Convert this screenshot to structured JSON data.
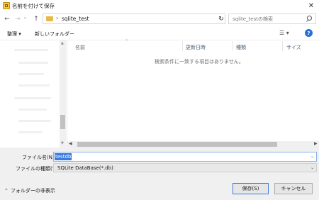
{
  "window": {
    "title": "名前を付けて保存",
    "close_glyph": "✕"
  },
  "address": {
    "back_glyph": "←",
    "forward_glyph": "→",
    "recent_glyph": "⌄",
    "up_glyph": "↑",
    "separator": "›",
    "path": "sqlite_test",
    "dropdown_glyph": "⌄",
    "refresh_glyph": "↻"
  },
  "search": {
    "placeholder": "sqlite_testの検索"
  },
  "toolbar": {
    "organize_label": "整理 ▾",
    "new_folder_label": "新しいフォルダー",
    "view_glyph": "☰ ▾",
    "help_glyph": "?"
  },
  "file_list": {
    "columns": [
      "名前",
      "更新日時",
      "種類",
      "サイズ"
    ],
    "sort_glyph": "⌃",
    "empty_message": "検索条件に一致する項目はありません。"
  },
  "scrollbar": {
    "left_glyph": "◀",
    "right_glyph": "▶",
    "up_glyph": "▲",
    "down_glyph": "▼"
  },
  "form": {
    "filename_label": "ファイル名(N):",
    "filename_value": "testdb",
    "filetype_label": "ファイルの種類(T):",
    "filetype_value": "SQLite DataBase(*.db)",
    "dropdown_glyph": "⌄"
  },
  "footer": {
    "hide_folders_label": "フォルダーの非表示",
    "hide_folders_glyph": "⌃",
    "save_label": "保存(S)",
    "cancel_label": "キャンセル"
  },
  "colors": {
    "accent": "#3b7ae0",
    "form_bg": "#f0f0f0",
    "folder": "#e8b84a"
  }
}
